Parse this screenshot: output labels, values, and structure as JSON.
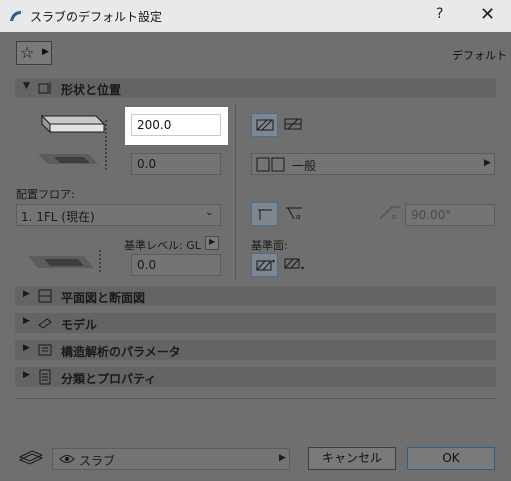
{
  "window": {
    "title": "スラブのデフォルト設定",
    "help_label": "?",
    "close_label": "✕"
  },
  "toolbar": {
    "favorites_icon": "star-icon",
    "default_label": "デフォルト"
  },
  "section_geometry": {
    "title": "形状と位置",
    "thickness_value": "200.0",
    "offset_value": "0.0",
    "floor_label": "配置フロア:",
    "floor_value": "1. 1FL (現在)",
    "ref_level_label": "基準レベル: GL",
    "ref_offset_value": "0.0",
    "composite_label": "一般",
    "angle_value": "90.00°",
    "ref_plane_label": "基準面:"
  },
  "sections": [
    {
      "label": "平面図と断面図"
    },
    {
      "label": "モデル"
    },
    {
      "label": "構造解析のパラメータ"
    },
    {
      "label": "分類とプロパティ"
    }
  ],
  "footer": {
    "layer_icon": "layer-icon",
    "visibility_icon": "eye-icon",
    "layer_value": "スラブ",
    "cancel_label": "キャンセル",
    "ok_label": "OK"
  },
  "colors": {
    "dialog_background": "#6f6f6f",
    "titlebar": "#e9e9e9",
    "active_field": "#ffffff",
    "ok_border": "#2d5d8a"
  }
}
